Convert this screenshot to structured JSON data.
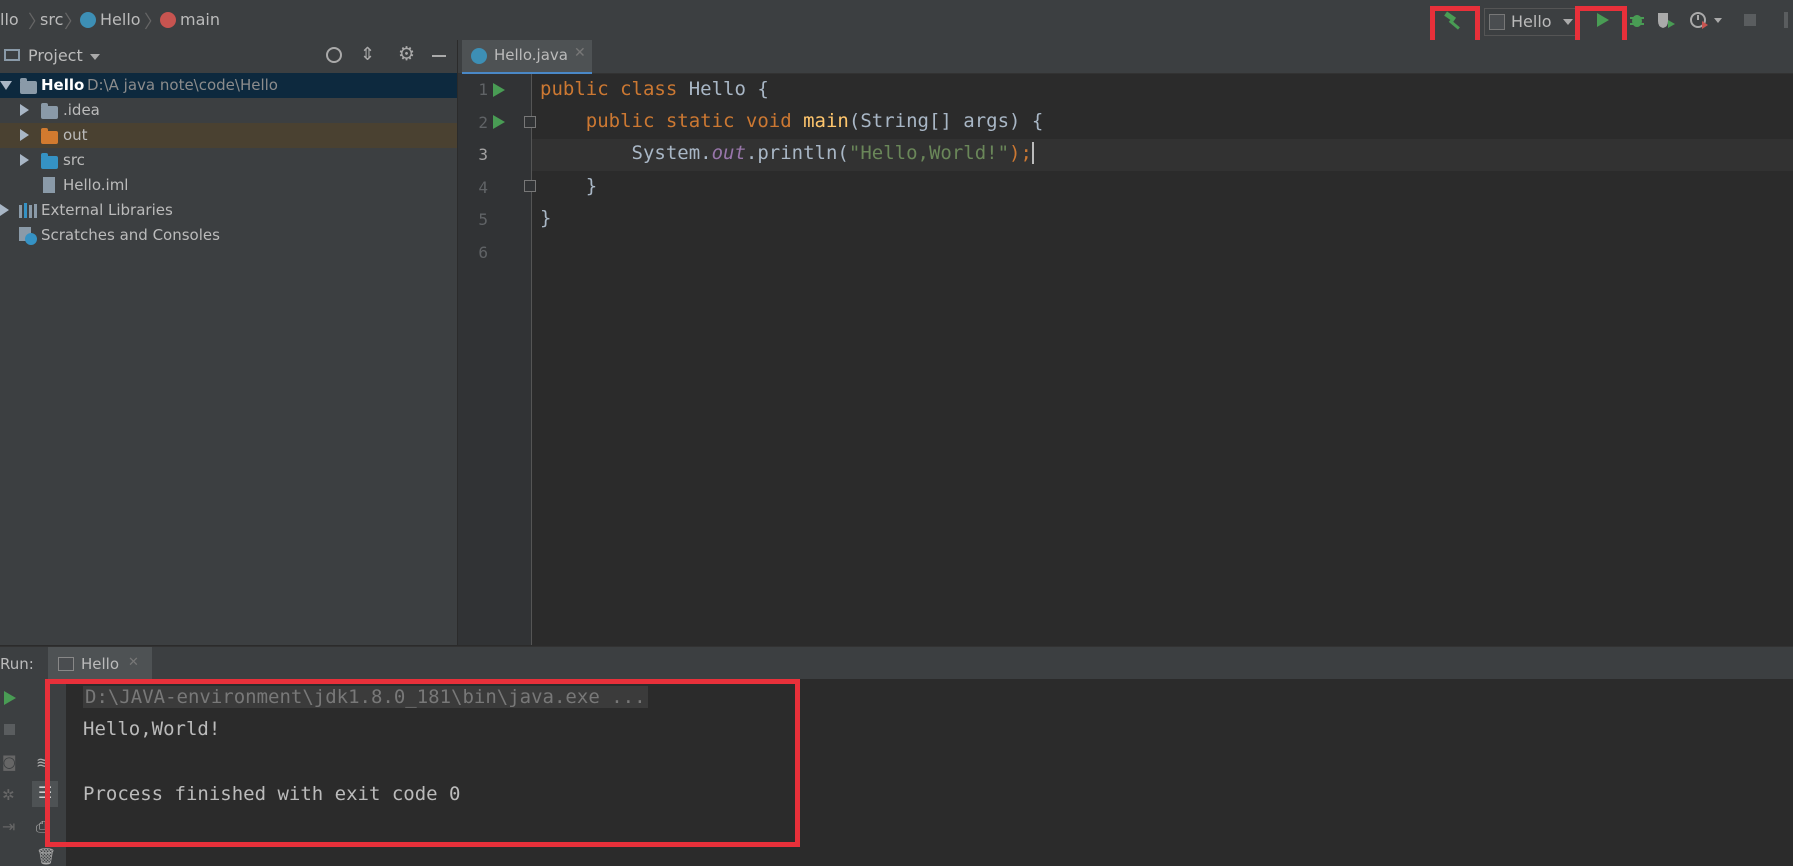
{
  "breadcrumb": {
    "items": [
      "llo",
      "src",
      "Hello",
      "main"
    ]
  },
  "toolbar": {
    "run_config": "Hello",
    "build_icon": "hammer-icon",
    "run_icon": "play-icon",
    "debug_icon": "bug-icon"
  },
  "project_panel": {
    "title": "Project",
    "root": {
      "name": "Hello",
      "path": "D:\\A java note\\code\\Hello"
    },
    "items": [
      {
        "name": ".idea",
        "type": "folder"
      },
      {
        "name": "out",
        "type": "folder-excluded"
      },
      {
        "name": "src",
        "type": "folder-source"
      },
      {
        "name": "Hello.iml",
        "type": "file"
      },
      {
        "name": "External Libraries",
        "type": "libraries"
      },
      {
        "name": "Scratches and Consoles",
        "type": "scratches"
      }
    ]
  },
  "editor": {
    "tab_label": "Hello.java",
    "line_numbers": [
      "1",
      "2",
      "3",
      "4",
      "5",
      "6"
    ],
    "code": {
      "l1_kw": "public class ",
      "l1_rest": "Hello {",
      "l2_indent": "    ",
      "l2_kw": "public static void ",
      "l2_fn": "main",
      "l2_rest": "(String[] args) {",
      "l3_indent": "        ",
      "l3_a": "System.",
      "l3_field": "out",
      "l3_b": ".println(",
      "l3_str": "\"Hello,World!\"",
      "l3_c": ");",
      "l4": "    }",
      "l5": "}"
    }
  },
  "run_panel": {
    "label": "Run:",
    "tab_label": "Hello",
    "output": [
      "D:\\JAVA-environment\\jdk1.8.0_181\\bin\\java.exe ...",
      "Hello,World!",
      "",
      "Process finished with exit code 0"
    ]
  },
  "colors": {
    "highlight_box": "#e8303a",
    "run_green": "#499c54",
    "accent_blue": "#4a88c7"
  }
}
